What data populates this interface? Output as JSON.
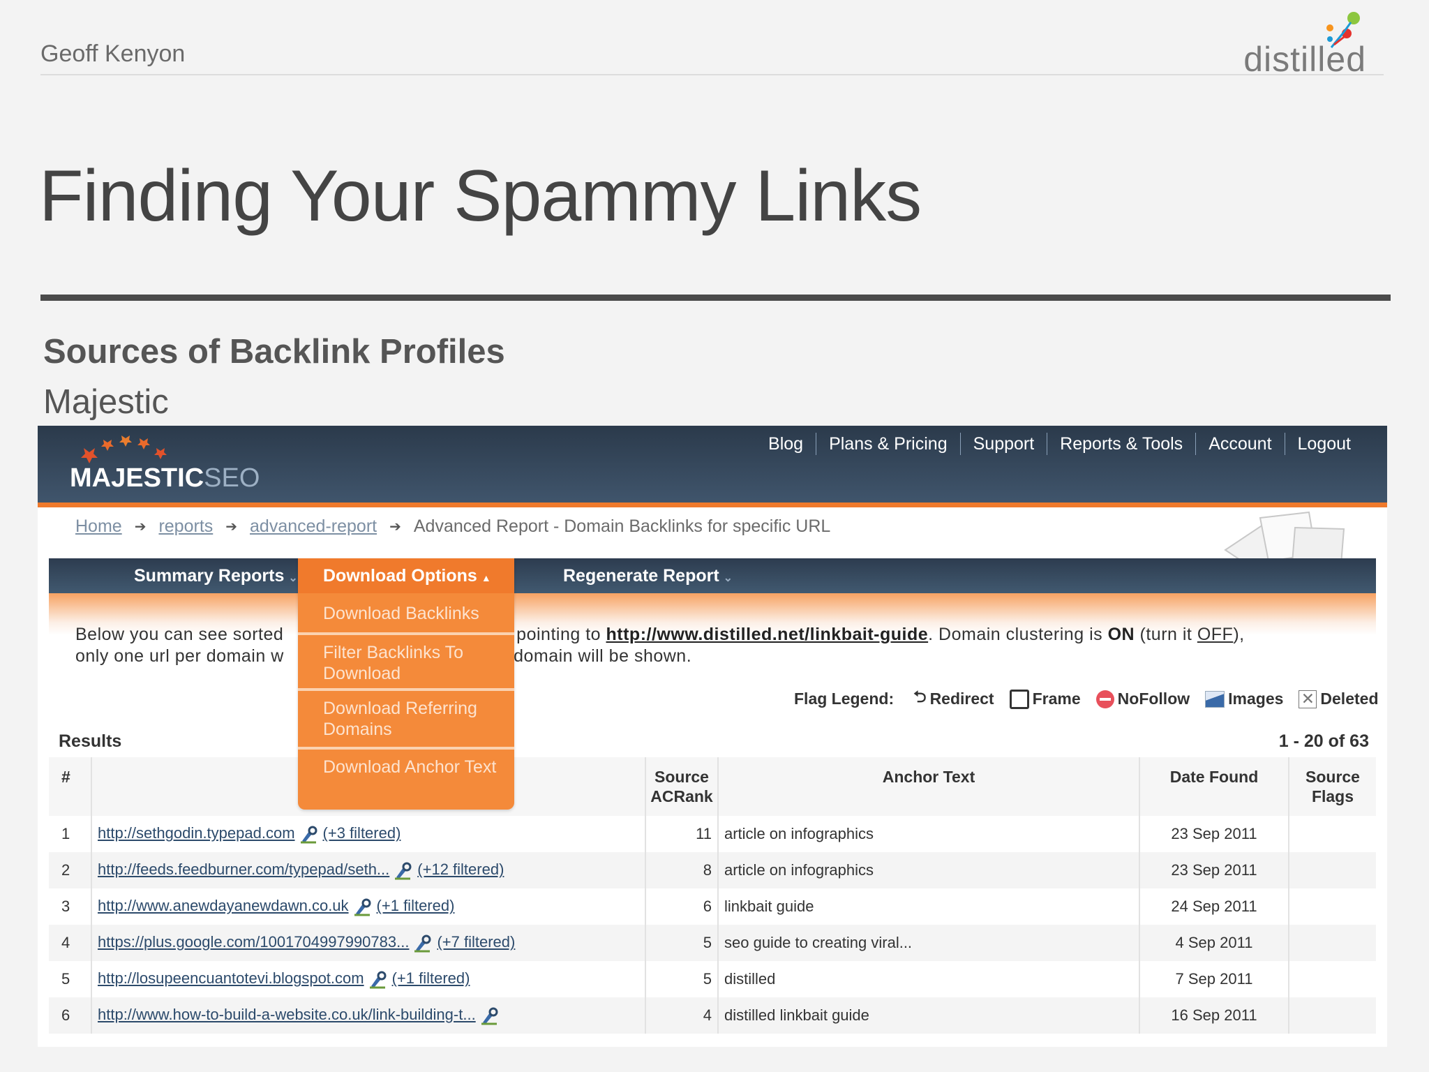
{
  "slide": {
    "author": "Geoff Kenyon",
    "brand": "distilled",
    "title": "Finding Your Spammy Links",
    "subtitle": "Sources of Backlink Profiles",
    "subsubtitle": "Majestic"
  },
  "majestic": {
    "logo_main": "MAJESTIC",
    "logo_suffix": "SEO",
    "nav": [
      "Blog",
      "Plans & Pricing",
      "Support",
      "Reports & Tools",
      "Account",
      "Logout"
    ],
    "breadcrumb": {
      "home": "Home",
      "reports": "reports",
      "advanced": "advanced-report",
      "current": "Advanced Report - Domain Backlinks for specific URL"
    },
    "tabs": {
      "summary": "Summary Reports",
      "download": "Download Options",
      "regenerate": "Regenerate Report"
    },
    "dropdown": [
      "Download Backlinks",
      "Filter Backlinks To Download",
      "Download Referring Domains",
      "Download Anchor Text"
    ],
    "intro": {
      "line1_a": "Below you can see sorted",
      "line1_b": "s pointing to",
      "url": "http://www.distilled.net/linkbait-guide",
      "line1_c": ". Domain clustering is",
      "on": "ON",
      "line1_d": "(turn it",
      "off": "OFF",
      "line1_e": "),",
      "line2_a": "only one url per domain w",
      "line2_b": "e domain will be shown."
    },
    "flag_legend": {
      "label": "Flag Legend:",
      "redirect": "Redirect",
      "frame": "Frame",
      "nofollow": "NoFollow",
      "images": "Images",
      "deleted": "Deleted"
    },
    "results_label": "Results",
    "paging": "1 - 20 of 63",
    "columns": {
      "num": "#",
      "acrank_1": "Source",
      "acrank_2": "ACRank",
      "anchor": "Anchor Text",
      "date": "Date Found",
      "flags_1": "Source",
      "flags_2": "Flags"
    },
    "rows": [
      {
        "n": "1",
        "url": "http://sethgodin.typepad.com",
        "filtered": "(+3 filtered)",
        "rank": "11",
        "anchor": "article on infographics",
        "date": "23 Sep 2011"
      },
      {
        "n": "2",
        "url": "http://feeds.feedburner.com/typepad/seth...",
        "filtered": "(+12 filtered)",
        "rank": "8",
        "anchor": "article on infographics",
        "date": "23 Sep 2011"
      },
      {
        "n": "3",
        "url": "http://www.anewdayanewdawn.co.uk",
        "filtered": "(+1 filtered)",
        "rank": "6",
        "anchor": "linkbait guide",
        "date": "24 Sep 2011"
      },
      {
        "n": "4",
        "url": "https://plus.google.com/1001704997990783...",
        "filtered": "(+7 filtered)",
        "rank": "5",
        "anchor": "seo guide to creating viral...",
        "date": "4 Sep 2011"
      },
      {
        "n": "5",
        "url": "http://losupeencuantotevi.blogspot.com",
        "filtered": "(+1 filtered)",
        "rank": "5",
        "anchor": "distilled",
        "date": "7 Sep 2011"
      },
      {
        "n": "6",
        "url": "http://www.how-to-build-a-website.co.uk/link-building-t...",
        "filtered": "",
        "rank": "4",
        "anchor": "distilled linkbait guide",
        "date": "16 Sep 2011"
      }
    ]
  }
}
